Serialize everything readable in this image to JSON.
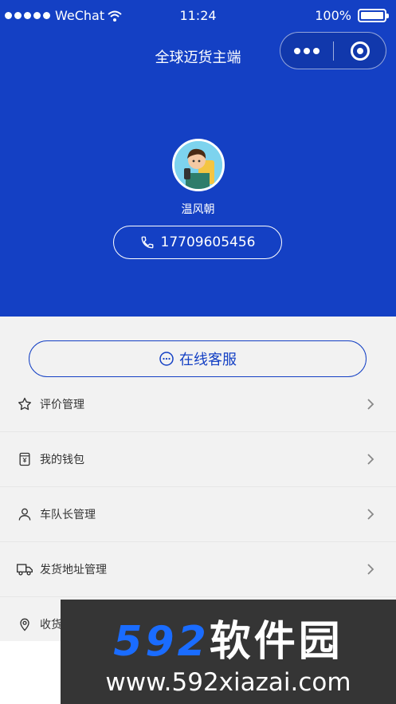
{
  "statusbar": {
    "carrier": "WeChat",
    "time": "11:24",
    "battery": "100%"
  },
  "nav": {
    "title": "全球迈货主端"
  },
  "profile": {
    "name": "温风朝",
    "phone": "17709605456"
  },
  "service": {
    "label": "在线客服"
  },
  "menu": [
    {
      "label": "评价管理",
      "icon": "star-icon"
    },
    {
      "label": "我的钱包",
      "icon": "wallet-icon"
    },
    {
      "label": "车队长管理",
      "icon": "person-icon"
    },
    {
      "label": "发货地址管理",
      "icon": "truck-icon"
    },
    {
      "label": "收货",
      "icon": "location-icon"
    }
  ],
  "watermark": {
    "brand_num": "592",
    "brand_cn": "软件园",
    "url": "www.592xiazai.com"
  },
  "colors": {
    "primary": "#1440c4",
    "background": "#f2f2f2"
  }
}
